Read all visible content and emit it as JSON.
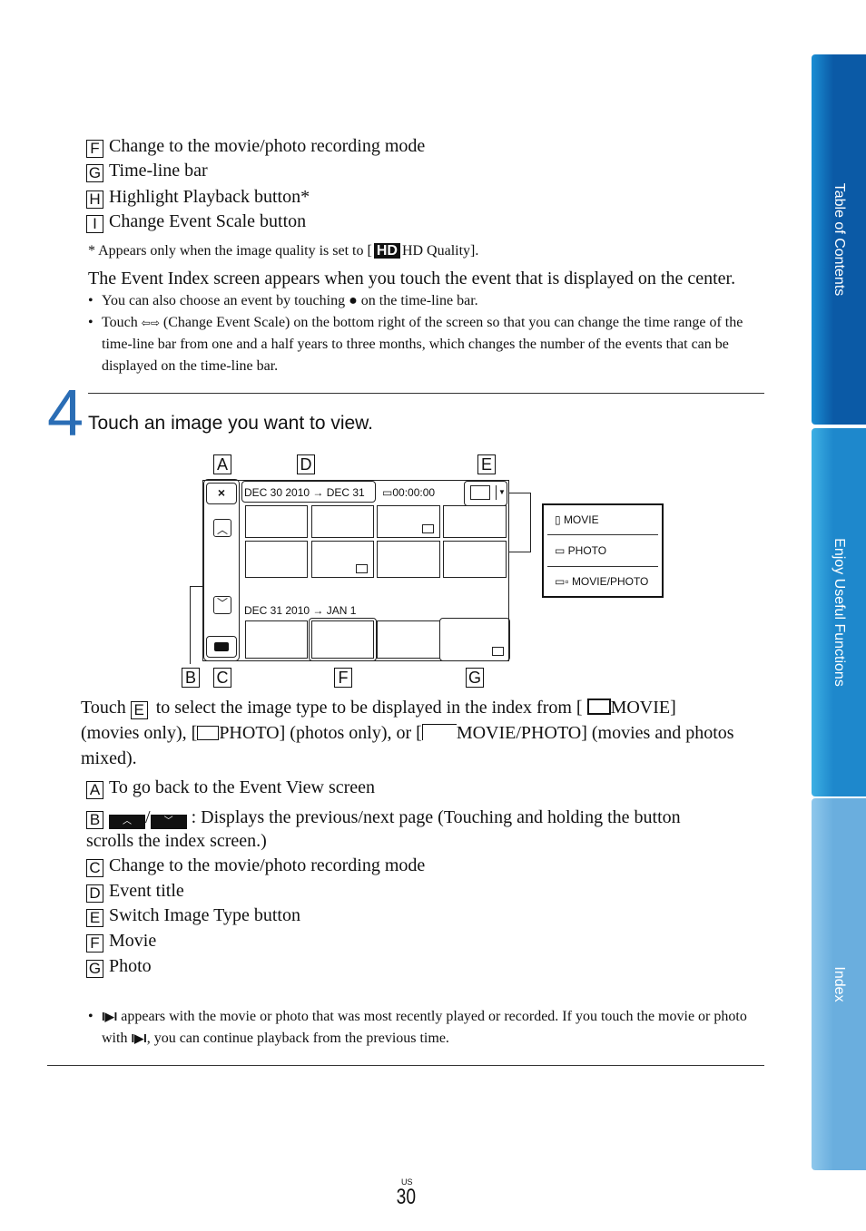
{
  "side_tabs": [
    {
      "label": "Table of Contents",
      "color": "#0b5aa6"
    },
    {
      "label": "Enjoy Useful Functions",
      "color": "#1e88cc"
    },
    {
      "label": "Index",
      "color": "#6aaede"
    }
  ],
  "top_items": [
    {
      "key": "F",
      "text": "Change to the movie/photo recording mode"
    },
    {
      "key": "G",
      "text": "Time-line bar"
    },
    {
      "key": "H",
      "text": "Highlight Playback button*"
    },
    {
      "key": "I",
      "text": "Change Event Scale button"
    }
  ],
  "footnote": {
    "pre": "*  Appears only when the image quality is set to [",
    "badge": "HD",
    "post": "HD Quality]."
  },
  "event_index_text": "The Event Index screen appears when you touch the event that is displayed on the center.",
  "bullets1": [
    {
      "pre": "You can also choose an event by touching ",
      "icon": "●",
      "post": " on the time-line bar."
    },
    {
      "pre": "Touch ",
      "icon": "⇦⇨",
      "post": " (Change Event Scale) on the bottom right of the screen so that you can change the time range of the time-line bar from one and a half years to three months, which changes the number of the events that can be displayed on the time-line bar."
    }
  ],
  "step": {
    "number": "4",
    "title": "Touch an image you want to view."
  },
  "diagram": {
    "event1": "DEC 30 2010 → DEC 31",
    "counter": "00:00:00",
    "event2": "DEC 31 2010 → JAN 1",
    "close": "×",
    "menu": [
      "MOVIE",
      "PHOTO",
      "MOVIE/PHOTO"
    ],
    "labels": {
      "A": "A",
      "B": "B",
      "C": "C",
      "D": "D",
      "E": "E",
      "F": "F",
      "G": "G"
    }
  },
  "touch_para": {
    "t1": "Touch ",
    "key": "E",
    "t2": " to select the image type to be displayed in the index from [",
    "movie": "MOVIE] (movies only), [",
    "photo": "PHOTO] (photos only), or [",
    "mp": "MOVIE/PHOTO] (movies and photos mixed)."
  },
  "items": [
    {
      "key": "A",
      "text": "To go back to the Event View screen"
    },
    {
      "key": "B",
      "text": ": Displays the previous/next page (Touching and holding the button scrolls the index screen.)"
    },
    {
      "key": "C",
      "text": "Change to the movie/photo recording mode"
    },
    {
      "key": "D",
      "text": "Event title"
    },
    {
      "key": "E",
      "text": "Switch Image Type button"
    },
    {
      "key": "F",
      "text": "Movie"
    },
    {
      "key": "G",
      "text": "Photo"
    }
  ],
  "bullet_last": {
    "icon": "I▶I",
    "pre": " appears with the movie or photo that was most recently played or recorded. If you touch the movie or photo with ",
    "post": ", you can continue playback from the previous time."
  },
  "footer": {
    "region": "US",
    "page": "30"
  }
}
